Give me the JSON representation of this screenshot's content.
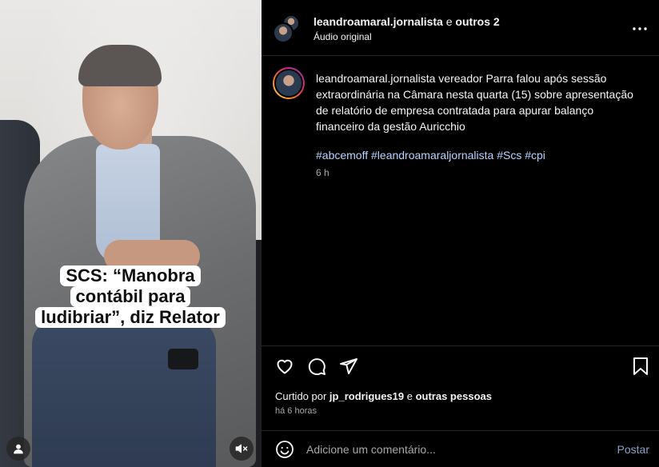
{
  "media": {
    "caption_lines": [
      "SCS: “Manobra",
      "contábil para",
      "ludibriar”, diz Relator"
    ],
    "icons": {
      "user_tag": "user-icon",
      "mute": "muted-speaker-icon"
    }
  },
  "header": {
    "username": "leandroamaral.jornalista",
    "connector": " e ",
    "others": "outros 2",
    "audio": "Áudio original",
    "more_icon": "three-dots-icon"
  },
  "post_caption": {
    "username": "leandroamaral.jornalista",
    "text": " vereador Parra falou após sessão extraordinária na Câmara nesta quarta (15) sobre apresentação de relatório de empresa contratada para apurar balanço financeiro da gestão Auricchio",
    "hashtags": [
      "#abcemoff",
      "#leandroamaraljornalista",
      "#Scs",
      "#cpi"
    ],
    "time": "6 h"
  },
  "actions": {
    "icons": [
      "heart-icon",
      "comment-icon",
      "share-icon",
      "bookmark-icon"
    ]
  },
  "likes": {
    "prefix": "Curtido por ",
    "user": "jp_rodrigues19",
    "middle": " e ",
    "others": "outras pessoas"
  },
  "posted_ago": "há 6 horas",
  "comment": {
    "placeholder": "Adicione um comentário...",
    "post_label": "Postar"
  }
}
